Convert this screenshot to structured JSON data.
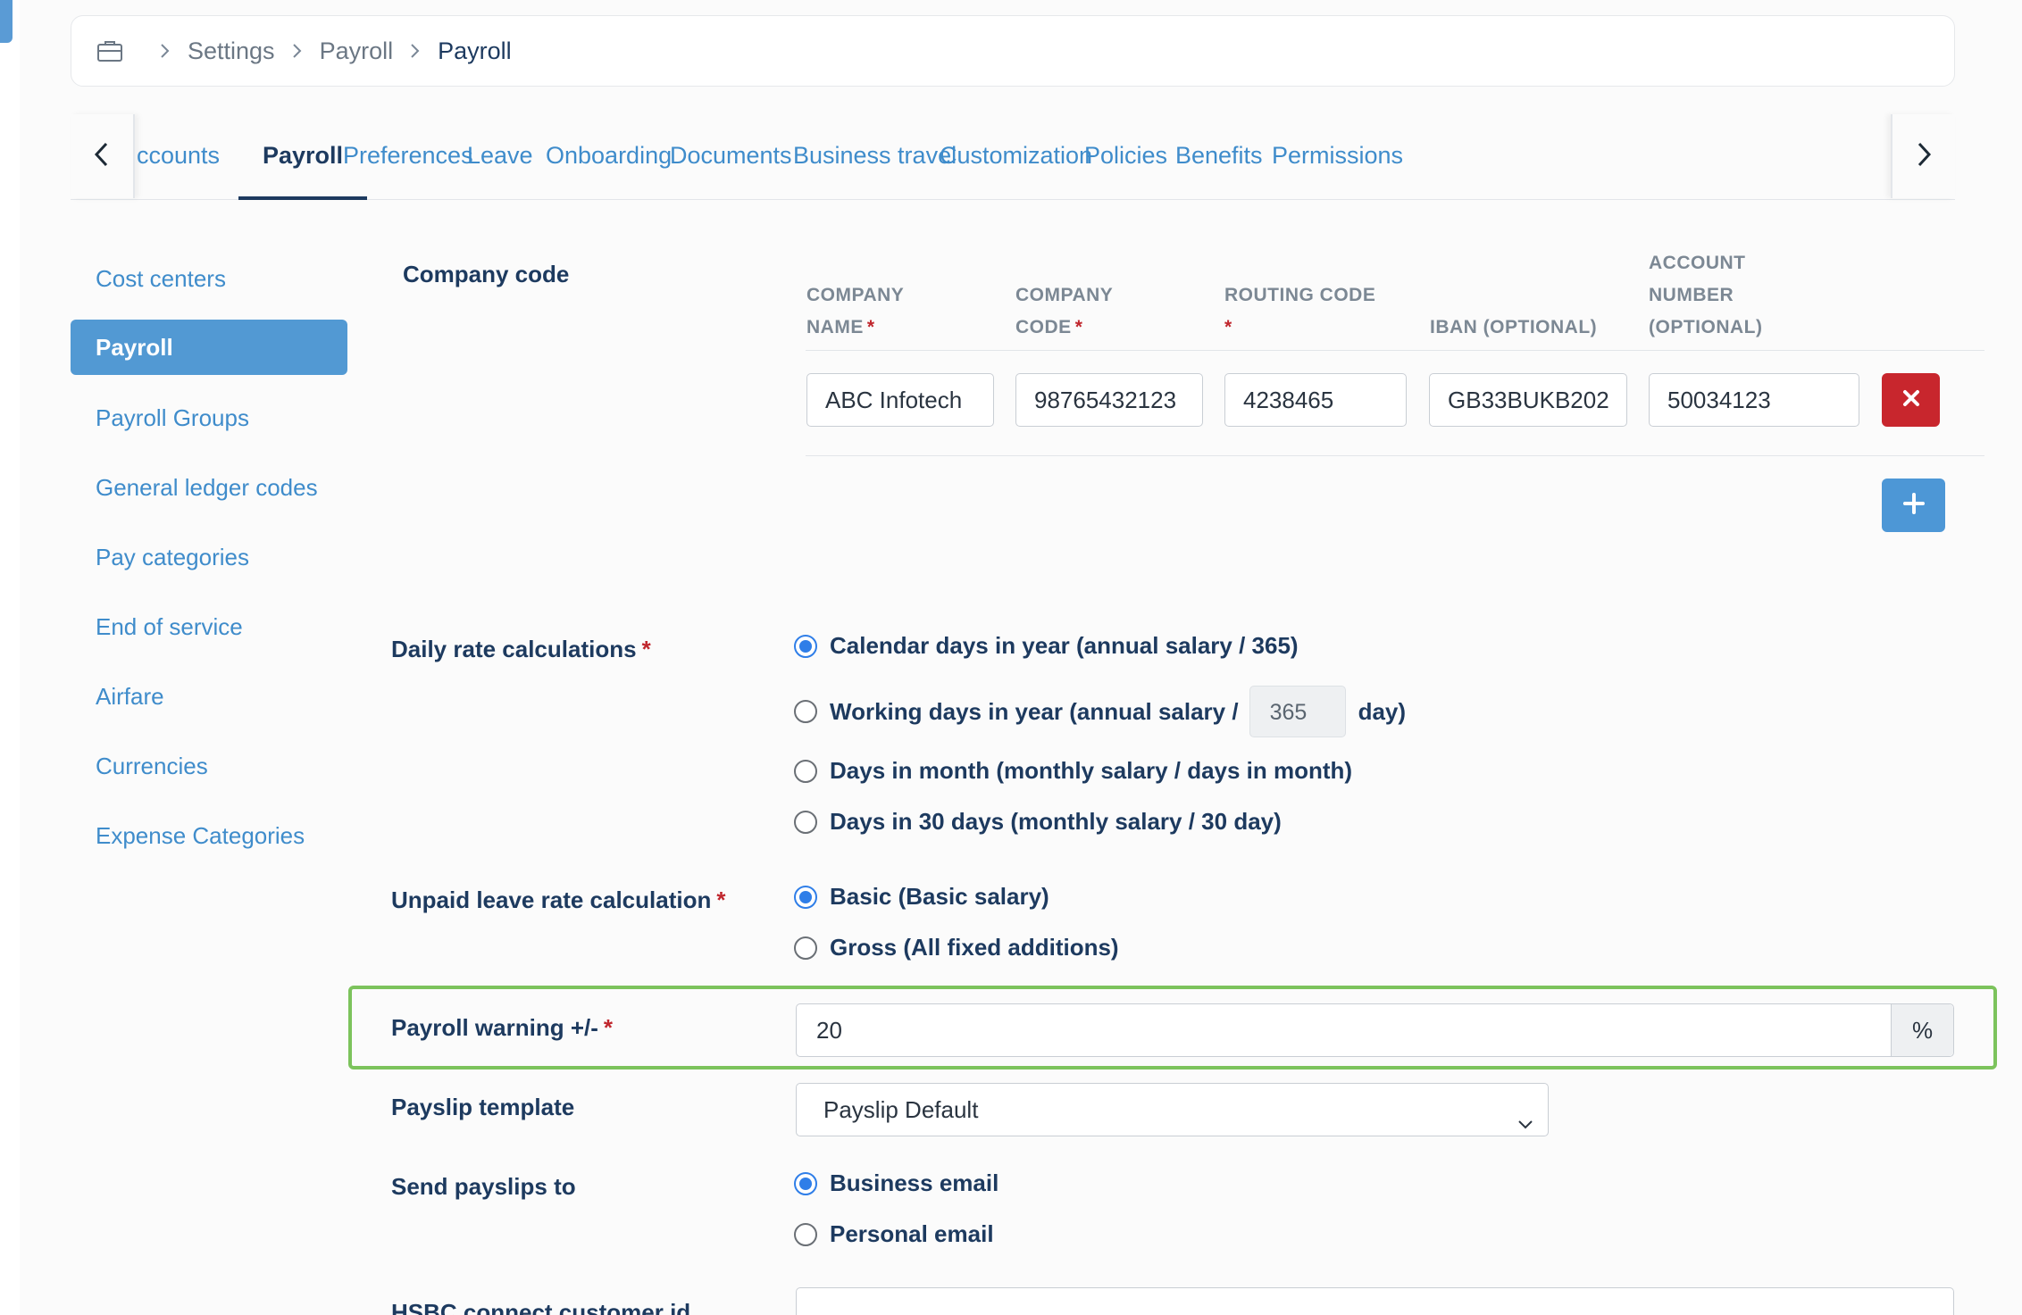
{
  "breadcrumb": {
    "icon": "briefcase-icon",
    "items": [
      "Settings",
      "Payroll"
    ],
    "current": "Payroll"
  },
  "tabs": [
    {
      "label": "ccounts"
    },
    {
      "label": "Payroll",
      "active": true
    },
    {
      "label": "Preferences"
    },
    {
      "label": "Leave"
    },
    {
      "label": "Onboarding"
    },
    {
      "label": "Documents"
    },
    {
      "label": "Business travel"
    },
    {
      "label": "Customization"
    },
    {
      "label": "Policies"
    },
    {
      "label": "Benefits"
    },
    {
      "label": "Permissions"
    }
  ],
  "sidebar": {
    "items": [
      {
        "label": "Cost centers"
      },
      {
        "label": "Payroll",
        "active": true
      },
      {
        "label": "Payroll Groups"
      },
      {
        "label": "General ledger codes"
      },
      {
        "label": "Pay categories"
      },
      {
        "label": "End of service"
      },
      {
        "label": "Airfare"
      },
      {
        "label": "Currencies"
      },
      {
        "label": "Expense Categories"
      }
    ]
  },
  "company_code": {
    "label": "Company code",
    "columns": {
      "company_name": [
        "COMPANY",
        "NAME"
      ],
      "company_code": [
        "COMPANY",
        "CODE"
      ],
      "routing_code": [
        "ROUTING CODE"
      ],
      "iban": "IBAN (OPTIONAL)",
      "account_number": [
        "ACCOUNT",
        "NUMBER",
        "(OPTIONAL)"
      ],
      "required_mark": "*"
    },
    "row": {
      "company_name": "ABC Infotech",
      "company_code": "98765432123",
      "routing_code": "4238465",
      "iban": "GB33BUKB202",
      "account_number": "50034123"
    }
  },
  "daily_rate": {
    "label": "Daily rate calculations",
    "required": "*",
    "options": [
      {
        "label": "Calendar days in year (annual salary / 365)",
        "checked": true
      },
      {
        "label_before": "Working days in year (annual salary /",
        "value": "365",
        "label_after": "day)",
        "checked": false
      },
      {
        "label": "Days in month (monthly salary / days in month)",
        "checked": false
      },
      {
        "label": "Days in 30 days (monthly salary / 30 day)",
        "checked": false
      }
    ]
  },
  "unpaid_leave": {
    "label": "Unpaid leave rate calculation",
    "required": "*",
    "options": [
      {
        "label": "Basic (Basic salary)",
        "checked": true
      },
      {
        "label": "Gross (All fixed additions)",
        "checked": false
      }
    ]
  },
  "payroll_warning": {
    "label": "Payroll warning +/-",
    "required": "*",
    "value": "20",
    "unit": "%"
  },
  "payslip_template": {
    "label": "Payslip template",
    "selected": "Payslip Default"
  },
  "send_payslips": {
    "label": "Send payslips to",
    "options": [
      {
        "label": "Business email",
        "checked": true
      },
      {
        "label": "Personal email",
        "checked": false
      }
    ]
  },
  "hsbc": {
    "label": "HSBC connect customer id"
  },
  "colors": {
    "accent": "#3f8ccb",
    "active_bg": "#5299d3",
    "danger": "#c8262d",
    "highlight": "#7cc35c",
    "text_dark": "#1d3a5f"
  }
}
